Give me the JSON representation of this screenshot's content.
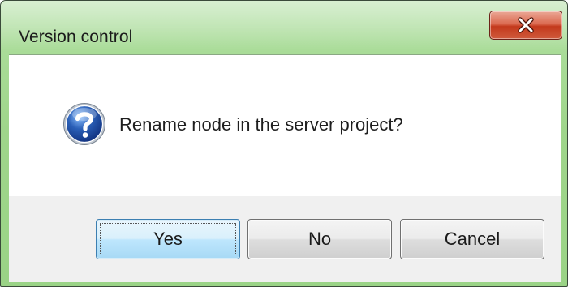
{
  "window": {
    "title": "Version control",
    "close_symbol": "x"
  },
  "message": {
    "icon": "question-icon",
    "text": "Rename node in the server project?"
  },
  "buttons": {
    "yes": "Yes",
    "no": "No",
    "cancel": "Cancel",
    "default": "yes"
  },
  "colors": {
    "title_bar": "#a9dc98",
    "close_button": "#c3391c",
    "default_button_border": "#3c7fb1",
    "button_area": "#f0f0f0",
    "question_icon": "#2a5fb7"
  }
}
